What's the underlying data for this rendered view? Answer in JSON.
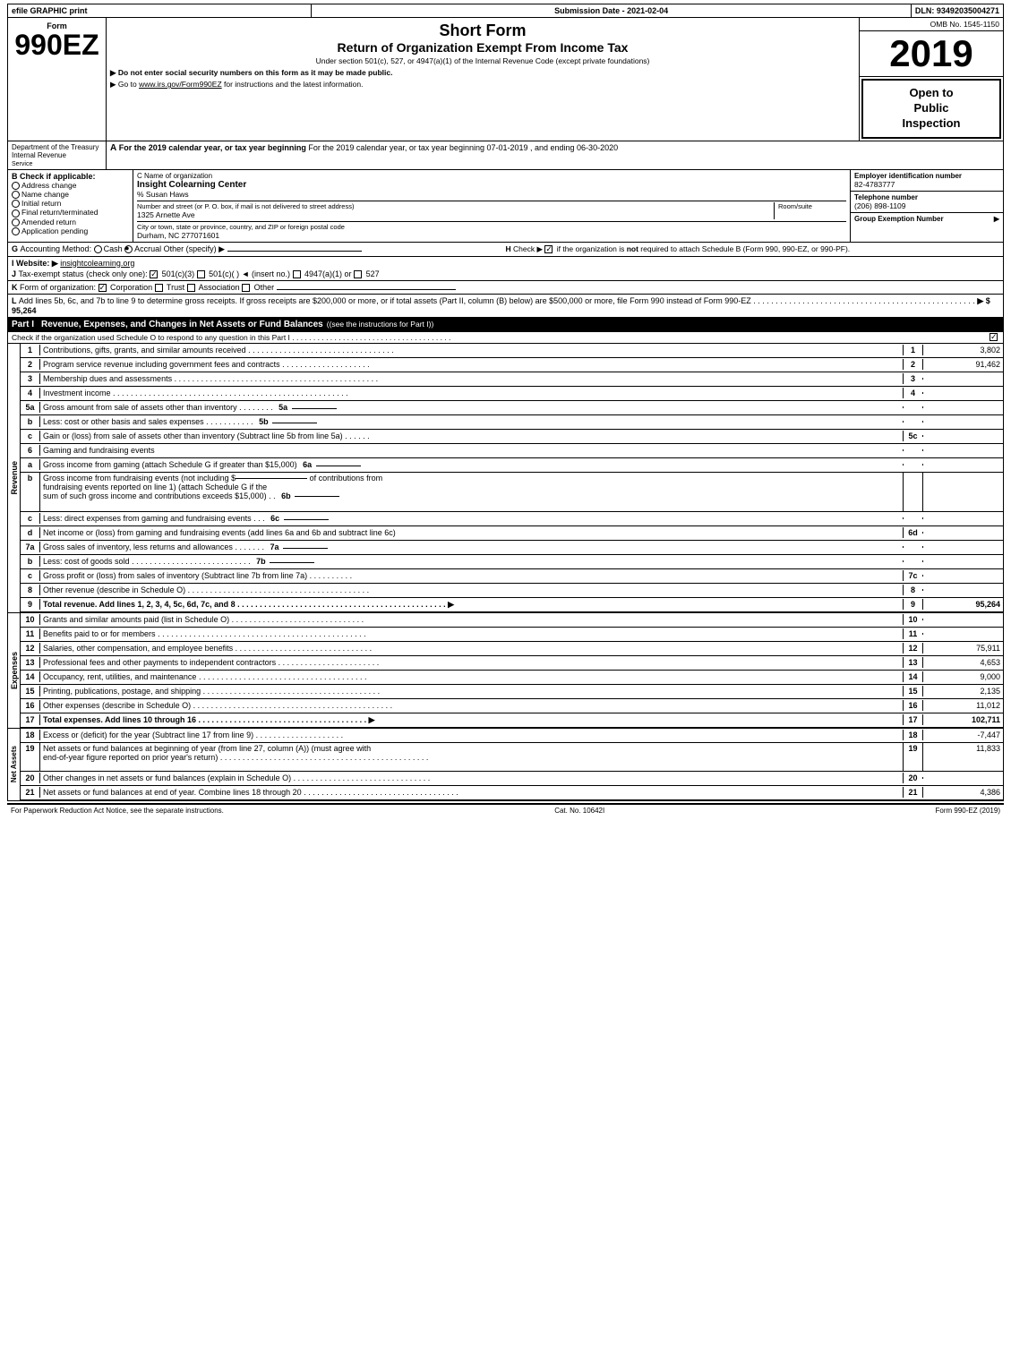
{
  "header_bar": {
    "efile": "efile GRAPHIC print",
    "submission": "Submission Date - 2021-02-04",
    "dln": "DLN: 93492035004271"
  },
  "form": {
    "number": "990EZ",
    "prefix": "Form",
    "short_form_title": "Short Form",
    "return_title": "Return of Organization Exempt From Income Tax",
    "subtitle": "Under section 501(c), 527, or 4947(a)(1) of the Internal Revenue Code (except private foundations)",
    "note1": "▶ Do not enter social security numbers on this form as it may be made public.",
    "note2": "▶ Go to www.irs.gov/Form990EZ for instructions and the latest information.",
    "omb": "OMB No. 1545-1150",
    "year": "2019",
    "open_to_public": "Open to Public Inspection"
  },
  "section_a": {
    "label": "A",
    "text": "For the 2019 calendar year, or tax year beginning 07-01-2019 , and ending 06-30-2020"
  },
  "section_b": {
    "label": "B",
    "title": "Check if applicable:",
    "items": [
      {
        "label": "Address change",
        "checked": false
      },
      {
        "label": "Name change",
        "checked": false
      },
      {
        "label": "Initial return",
        "checked": false
      },
      {
        "label": "Final return/terminated",
        "checked": false
      },
      {
        "label": "Amended return",
        "checked": false
      },
      {
        "label": "Application pending",
        "checked": false
      }
    ]
  },
  "section_c": {
    "label": "C",
    "title": "Name of organization",
    "org_name": "Insight Colearning Center",
    "care_of": "% Susan Haws",
    "street_label": "Number and street (or P. O. box, if mail is not delivered to street address)",
    "street": "1325 Arnette Ave",
    "room_suite_label": "Room/suite",
    "room_suite": "",
    "city_label": "City or town, state or province, country, and ZIP or foreign postal code",
    "city": "Durham, NC 277071601"
  },
  "section_d": {
    "label": "D",
    "title": "Employer identification number",
    "ein": "82-4783777"
  },
  "section_e": {
    "label": "E",
    "title": "Telephone number",
    "phone": "(206) 898-1109"
  },
  "section_f": {
    "label": "F",
    "title": "Group Exemption Number",
    "arrow": "▶"
  },
  "section_g": {
    "label": "G",
    "title": "Accounting Method:",
    "cash": "Cash",
    "accrual": "Accrual",
    "accrual_checked": true,
    "other": "Other (specify) ▶",
    "other_value": ""
  },
  "section_h": {
    "label": "H",
    "text": "Check ▶",
    "checkbox_label": "if the organization is not required to attach Schedule B (Form 990, 990-EZ, or 990-PF).",
    "checked": true
  },
  "section_i": {
    "label": "I",
    "title": "Website: ▶",
    "url": "insightcolearning.org"
  },
  "section_j": {
    "label": "J",
    "text": "Tax-exempt status (check only one):",
    "options": [
      {
        "label": "501(c)(3)",
        "checked": true
      },
      {
        "label": "501(c)(  )◄ (insert no.)",
        "checked": false
      },
      {
        "label": "4947(a)(1) or",
        "checked": false
      },
      {
        "label": "527",
        "checked": false
      }
    ]
  },
  "section_k": {
    "label": "K",
    "text": "Form of organization:",
    "options": [
      {
        "label": "Corporation",
        "checked": true
      },
      {
        "label": "Trust",
        "checked": false
      },
      {
        "label": "Association",
        "checked": false
      },
      {
        "label": "Other",
        "checked": false
      }
    ]
  },
  "section_l": {
    "label": "L",
    "text": "Add lines 5b, 6c, and 7b to line 9 to determine gross receipts. If gross receipts are $200,000 or more, or if total assets (Part II, column (B) below) are $500,000 or more, file Form 990 instead of Form 990-EZ",
    "dots": ". . . . . . . . . . . . . . . . . . . . . . . . . . . . . . . . . . . . . . . . . . . . . . . . . .",
    "arrow": "▶ $",
    "value": "95,264"
  },
  "part1": {
    "label": "Part I",
    "title": "Revenue, Expenses, and Changes in Net Assets or Fund Balances",
    "subtitle": "(see the instructions for Part I)",
    "check_note": "Check if the organization used Schedule O to respond to any question in this Part I",
    "check_dots": ". . . . . . . . . . . . . . . . . . . . . . .",
    "check_box": true,
    "lines": [
      {
        "num": "1",
        "desc": "Contributions, gifts, grants, and similar amounts received",
        "dots": ". . . . . . . . . . . . . . . . . . . . . . . . . . . . . . . . .",
        "line_num": "1",
        "amount": "3,802"
      },
      {
        "num": "2",
        "desc": "Program service revenue including government fees and contracts",
        "dots": ". . . . . . . . . . . . . . . . . . . .",
        "line_num": "2",
        "amount": "91,462"
      },
      {
        "num": "3",
        "desc": "Membership dues and assessments",
        "dots": ". . . . . . . . . . . . . . . . . . . . . . . . . . . . . . . . . . . . . . . . . . . . . .",
        "line_num": "3",
        "amount": ""
      },
      {
        "num": "4",
        "desc": "Investment income",
        "dots": ". . . . . . . . . . . . . . . . . . . . . . . . . . . . . . . . . . . . . . . . . . . . . . . . . . . . .",
        "line_num": "4",
        "amount": ""
      },
      {
        "num": "5a",
        "desc": "Gross amount from sale of assets other than inventory",
        "dots": ". . . . . . . .",
        "sub_label": "5a",
        "sub_box": "",
        "line_num": "",
        "amount": ""
      },
      {
        "num": "5b",
        "sub": "b",
        "desc": "Less: cost or other basis and sales expenses",
        "dots": ". . . . . . . . . . .",
        "sub_label": "5b",
        "sub_box": "",
        "line_num": "",
        "amount": ""
      },
      {
        "num": "5c",
        "sub": "c",
        "desc": "Gain or (loss) from sale of assets other than inventory (Subtract line 5b from line 5a)",
        "dots": ". . . . . .",
        "line_num": "5c",
        "amount": ""
      },
      {
        "num": "6",
        "desc": "Gaming and fundraising events",
        "line_num": "",
        "amount": ""
      },
      {
        "num": "6a",
        "sub": "a",
        "desc": "Gross income from gaming (attach Schedule G if greater than $15,000)",
        "sub_label": "6a",
        "sub_box": "",
        "line_num": "",
        "amount": ""
      },
      {
        "num": "6b",
        "sub": "b",
        "desc": "Gross income from fundraising events (not including $                            of contributions from fundraising events reported on line 1) (attach Schedule G if the sum of such gross income and contributions exceeds $15,000)",
        "dots": ". .",
        "sub_label": "6b",
        "sub_box": "",
        "line_num": "",
        "amount": ""
      },
      {
        "num": "6c",
        "sub": "c",
        "desc": "Less: direct expenses from gaming and fundraising events",
        "dots": ". . .",
        "sub_label": "6c",
        "sub_box": "",
        "line_num": "",
        "amount": ""
      },
      {
        "num": "6d",
        "sub": "d",
        "desc": "Net income or (loss) from gaming and fundraising events (add lines 6a and 6b and subtract line 6c)",
        "line_num": "6d",
        "amount": ""
      },
      {
        "num": "7a",
        "desc": "Gross sales of inventory, less returns and allowances",
        "dots": ". . . . . . .",
        "sub_label": "7a",
        "sub_box": "",
        "line_num": "",
        "amount": ""
      },
      {
        "num": "7b",
        "sub": "b",
        "desc": "Less: cost of goods sold",
        "dots": ". . . . . . . . . . . . . . . . . . . . . . . . . . .",
        "sub_label": "7b",
        "sub_box": "",
        "line_num": "",
        "amount": ""
      },
      {
        "num": "7c",
        "sub": "c",
        "desc": "Gross profit or (loss) from sales of inventory (Subtract line 7b from line 7a)",
        "dots": ". . . . . . . . . .",
        "line_num": "7c",
        "amount": ""
      },
      {
        "num": "8",
        "desc": "Other revenue (describe in Schedule O)",
        "dots": ". . . . . . . . . . . . . . . . . . . . . . . . . . . . . . . . . . . . . . . . .",
        "line_num": "8",
        "amount": ""
      },
      {
        "num": "9",
        "desc": "Total revenue. Add lines 1, 2, 3, 4, 5c, 6d, 7c, and 8",
        "dots": ". . . . . . . . . . . . . . . . . . . . . . . . . . . . . . . . . . . . . . . . . . . . . . .",
        "arrow": "▶",
        "line_num": "9",
        "amount": "95,264",
        "bold": true
      }
    ]
  },
  "expenses_lines": [
    {
      "num": "10",
      "desc": "Grants and similar amounts paid (list in Schedule O)",
      "dots": ". . . . . . . . . . . . . . . . . . . . . . . . . . . . . .",
      "line_num": "10",
      "amount": ""
    },
    {
      "num": "11",
      "desc": "Benefits paid to or for members",
      "dots": ". . . . . . . . . . . . . . . . . . . . . . . . . . . . . . . . . . . . . . . . . . . . . . .",
      "line_num": "11",
      "amount": ""
    },
    {
      "num": "12",
      "desc": "Salaries, other compensation, and employee benefits",
      "dots": ". . . . . . . . . . . . . . . . . . . . . . . . . . . . . . .",
      "line_num": "12",
      "amount": "75,911"
    },
    {
      "num": "13",
      "desc": "Professional fees and other payments to independent contractors",
      "dots": ". . . . . . . . . . . . . . . . . . . . . . .",
      "line_num": "13",
      "amount": "4,653"
    },
    {
      "num": "14",
      "desc": "Occupancy, rent, utilities, and maintenance",
      "dots": ". . . . . . . . . . . . . . . . . . . . . . . . . . . . . . . . . . . . . .",
      "line_num": "14",
      "amount": "9,000"
    },
    {
      "num": "15",
      "desc": "Printing, publications, postage, and shipping",
      "dots": ". . . . . . . . . . . . . . . . . . . . . . . . . . . . . . . . . . . . . . . .",
      "line_num": "15",
      "amount": "2,135"
    },
    {
      "num": "16",
      "desc": "Other expenses (describe in Schedule O)",
      "dots": ". . . . . . . . . . . . . . . . . . . . . . . . . . . . . . . . . . . . . . . . . . . . .",
      "line_num": "16",
      "amount": "11,012"
    },
    {
      "num": "17",
      "desc": "Total expenses. Add lines 10 through 16",
      "dots": ". . . . . . . . . . . . . . . . . . . . . . . . . . . . . . . . . . . . . .",
      "arrow": "▶",
      "line_num": "17",
      "amount": "102,711",
      "bold": true
    }
  ],
  "net_assets_lines": [
    {
      "num": "18",
      "desc": "Excess or (deficit) for the year (Subtract line 17 from line 9)",
      "dots": ". . . . . . . . . . . . . . . . . . . .",
      "line_num": "18",
      "amount": "-7,447"
    },
    {
      "num": "19",
      "desc": "Net assets or fund balances at beginning of year (from line 27, column (A)) (must agree with end-of-year figure reported on prior year's return)",
      "dots": ". . . . . . . . . . . . . . . . . . . . . . . . . . . . . . . . . . . . . . . . . . . . . . .",
      "line_num": "19",
      "amount": "11,833"
    },
    {
      "num": "20",
      "desc": "Other changes in net assets or fund balances (explain in Schedule O)",
      "dots": ". . . . . . . . . . . . . . . . . . . . . . . . . . . . . . .",
      "line_num": "20",
      "amount": ""
    },
    {
      "num": "21",
      "desc": "Net assets or fund balances at end of year. Combine lines 18 through 20",
      "dots": ". . . . . . . . . . . . . . . . . . . . . . . . . . . . . . . . . . . .",
      "line_num": "21",
      "amount": "4,386"
    }
  ],
  "footer": {
    "left": "For Paperwork Reduction Act Notice, see the separate instructions.",
    "center": "Cat. No. 10642I",
    "right": "Form 990-EZ (2019)"
  },
  "revenue_label": "Revenue",
  "expenses_label": "Expenses",
  "net_assets_label": "Net Assets"
}
